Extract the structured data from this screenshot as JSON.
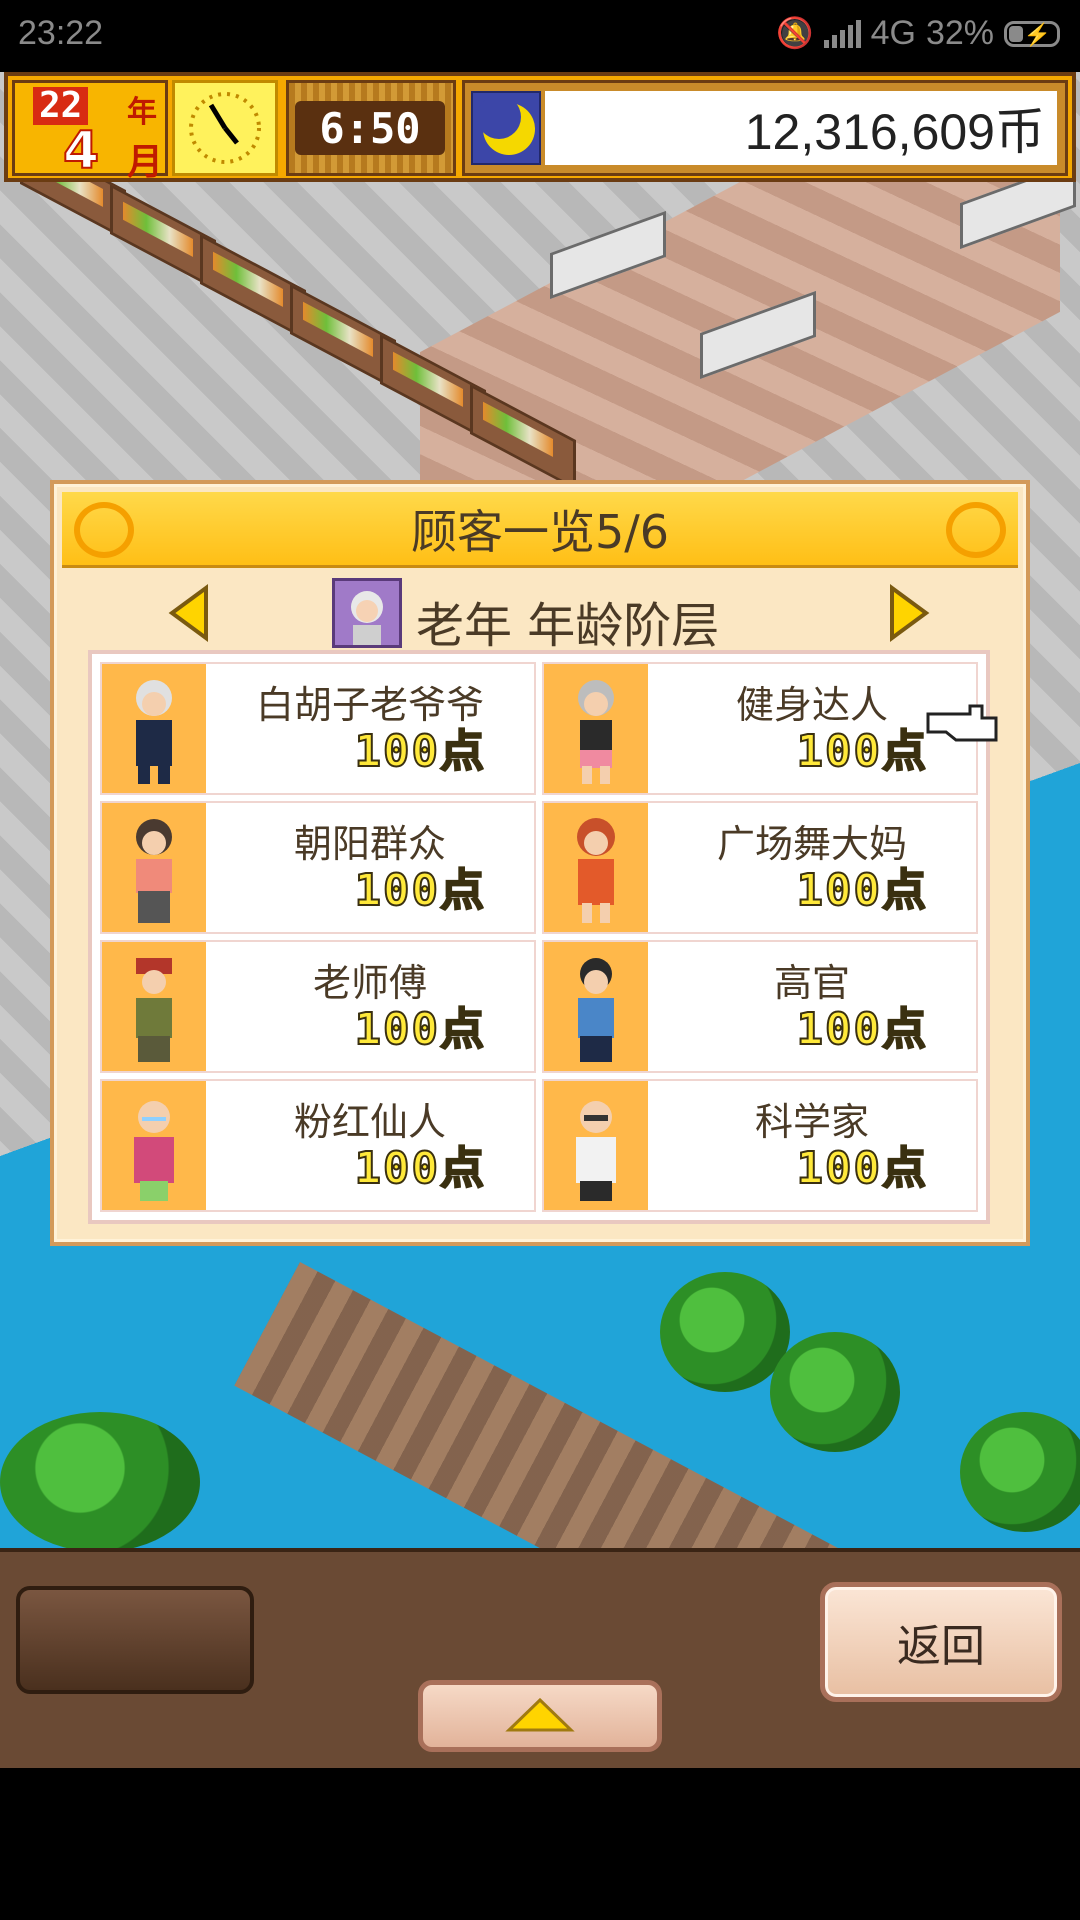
{
  "status_bar": {
    "time": "23:22",
    "network": "4G",
    "battery": "32%"
  },
  "hud": {
    "year_value": "22",
    "year_unit": "年",
    "month_value": "4",
    "month_unit": "月",
    "clock_time": "6:50",
    "money": "12,316,609币"
  },
  "dialog": {
    "title": "顾客一览5/6",
    "category": "老年 年龄阶层",
    "customers": [
      {
        "name": "白胡子老爷爷",
        "points": "100点"
      },
      {
        "name": "健身达人",
        "points": "100点"
      },
      {
        "name": "朝阳群众",
        "points": "100点"
      },
      {
        "name": "广场舞大妈",
        "points": "100点"
      },
      {
        "name": "老师傅",
        "points": "100点"
      },
      {
        "name": "高官",
        "points": "100点"
      },
      {
        "name": "粉红仙人",
        "points": "100点"
      },
      {
        "name": "科学家",
        "points": "100点"
      }
    ]
  },
  "bottom": {
    "back_label": "返回"
  },
  "icons": {
    "prev": "left-arrow-icon",
    "next": "right-arrow-icon",
    "up": "up-arrow-icon",
    "pointer": "pointing-hand-icon",
    "moon": "moon-icon",
    "clock": "clock-icon"
  },
  "colors": {
    "accent_gold": "#ffbf16",
    "dialog_bg": "#fbe7c3",
    "portrait_bg": "#ffb84a",
    "points_text": "#ffe93a"
  }
}
